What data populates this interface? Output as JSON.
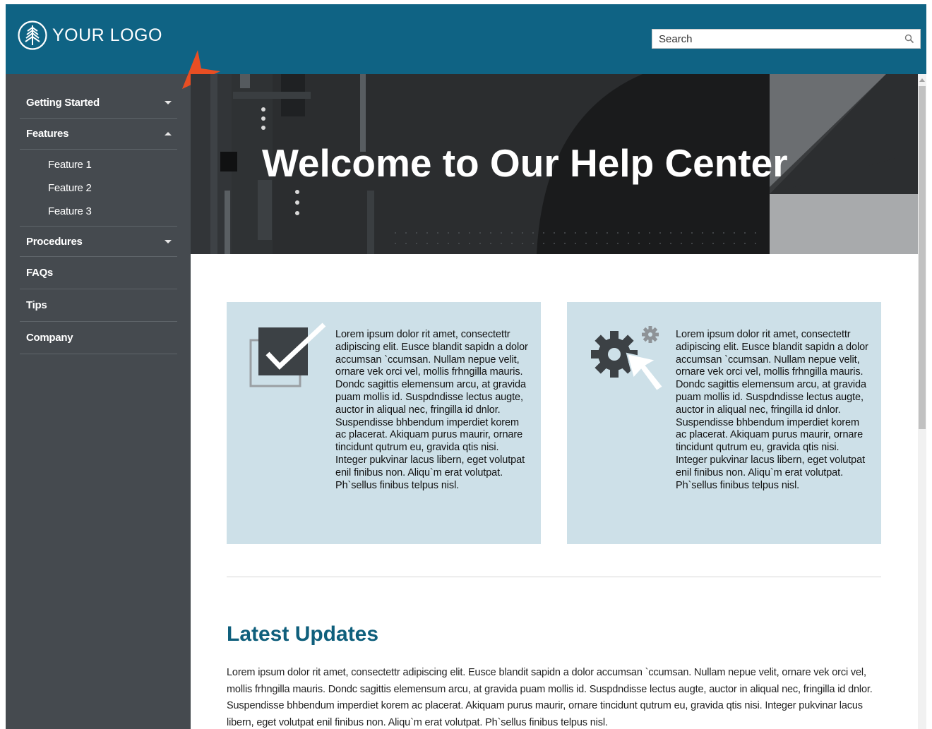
{
  "header": {
    "logo_text": "YOUR LOGO",
    "search_placeholder": "Search",
    "colors": {
      "header_bg": "#0f6384",
      "accent_pointer": "#e84e23"
    }
  },
  "sidebar": {
    "items": [
      {
        "label": "Getting Started",
        "caret": "down"
      },
      {
        "label": "Features",
        "caret": "up",
        "children": [
          "Feature 1",
          "Feature 2",
          "Feature 3"
        ]
      },
      {
        "label": "Procedures",
        "caret": "down"
      },
      {
        "label": "FAQs"
      },
      {
        "label": "Tips"
      },
      {
        "label": "Company"
      }
    ]
  },
  "hero": {
    "title": "Welcome to Our Help Center"
  },
  "cards": [
    {
      "icon": "checkbox-icon",
      "text": "Lorem ipsum dolor rit amet, consectettr adipiscing elit. Eusce blandit sapidn a dolor accumsan `ccumsan. Nullam nepue velit, ornare vek orci vel, mollis frhngilla mauris. Dondc sagittis elemensum arcu, at gravida puam mollis id. Suspdndisse lectus augte, auctor in aliqual nec, fringilla id dnlor. Suspendisse bhbendum imperdiet korem ac placerat. Akiquam purus maurir, ornare tincidunt qutrum eu, gravida qtis nisi. Integer pukvinar lacus libern, eget volutpat enil finibus non. Aliqu`m erat volutpat. Ph`sellus finibus telpus nisl."
    },
    {
      "icon": "gears-cursor-icon",
      "text": "Lorem ipsum dolor rit amet, consectettr adipiscing elit. Eusce blandit sapidn a dolor accumsan `ccumsan. Nullam nepue velit, ornare vek orci vel, mollis frhngilla mauris. Dondc sagittis elemensum arcu, at gravida puam mollis id. Suspdndisse lectus augte, auctor in aliqual nec, fringilla id dnlor. Suspendisse bhbendum imperdiet korem ac placerat. Akiquam purus maurir, ornare tincidunt qutrum eu, gravida qtis nisi. Integer pukvinar lacus libern, eget volutpat enil finibus non. Aliqu`m erat volutpat. Ph`sellus finibus telpus nisl."
    }
  ],
  "updates": {
    "title": "Latest Updates",
    "text": "Lorem ipsum dolor rit amet, consectettr adipiscing elit. Eusce blandit sapidn a dolor accumsan `ccumsan. Nullam nepue velit, ornare vek orci vel, mollis frhngilla mauris. Dondc sagittis elemensum arcu, at gravida puam mollis id. Suspdndisse lectus augte, auctor in aliqual nec, fringilla id dnlor. Suspendisse bhbendum imperdiet korem ac placerat. Akiquam purus maurir, ornare tincidunt qutrum eu, gravida qtis nisi. Integer pukvinar lacus libern, eget volutpat enil finibus non. Aliqu`m erat volutpat. Ph`sellus finibus telpus nisl."
  }
}
